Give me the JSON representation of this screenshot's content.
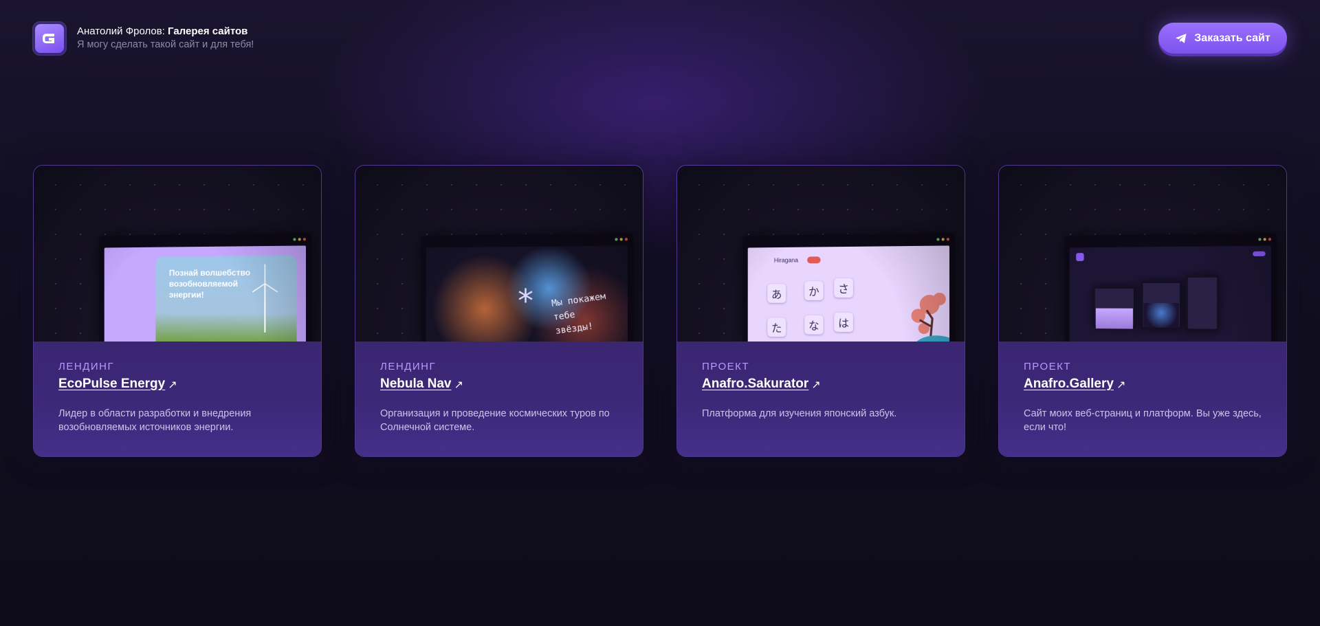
{
  "header": {
    "logo_icon": "gallery-logo-icon",
    "author": "Анатолий Фролов:",
    "title": "Галерея сайтов",
    "subtitle": "Я могу сделать такой сайт и для тебя!",
    "order_button": {
      "label": "Заказать сайт",
      "icon": "telegram-send-icon"
    }
  },
  "cards": [
    {
      "category": "ЛЕНДИНГ",
      "title": "EcoPulse Energy",
      "link_icon": "↗",
      "description": "Лидер в области разработки и внедрения возобновляемых источников энергии.",
      "preview": {
        "hero_text": "Познай волшебство возобновляемой энергии!"
      }
    },
    {
      "category": "ЛЕНДИНГ",
      "title": "Nebula Nav",
      "link_icon": "↗",
      "description": "Организация и проведение космических туров по Солнечной системе.",
      "preview": {
        "tagline": "Мы покажем тебе звёзды!"
      }
    },
    {
      "category": "ПРОЕКТ",
      "title": "Anafro.Sakurator",
      "link_icon": "↗",
      "description": "Платформа для изучения японский азбук.",
      "preview": {
        "mode": "Hiragana",
        "kana": [
          "あ",
          "か",
          "さ",
          "た",
          "な",
          "は"
        ]
      }
    },
    {
      "category": "ПРОЕКТ",
      "title": "Anafro.Gallery",
      "link_icon": "↗",
      "description": "Сайт моих веб-страниц и платформ. Вы уже здесь, если что!",
      "preview": {}
    }
  ],
  "colors": {
    "accent": "#8b5cf6",
    "card_body": "#3d2879",
    "category": "#b79aff",
    "background": "#120f22"
  }
}
